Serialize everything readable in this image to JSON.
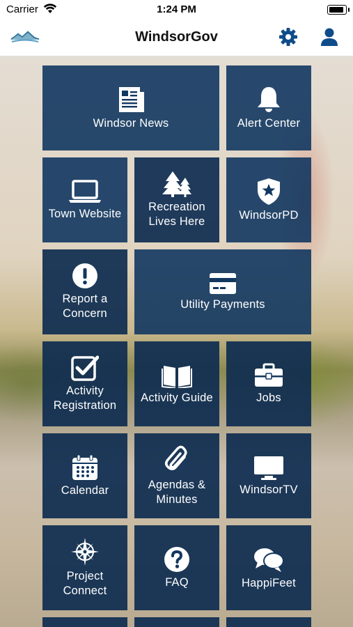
{
  "status_bar": {
    "carrier": "Carrier",
    "time": "1:24 PM",
    "battery_level": 0.9
  },
  "nav_bar": {
    "title": "WindsorGov",
    "logo_icon": "mountains-logo-icon",
    "settings_icon": "gear-icon",
    "account_icon": "user-icon"
  },
  "tiles": [
    {
      "label": "Windsor News",
      "icon": "newspaper-icon"
    },
    {
      "label": "Alert Center",
      "icon": "bell-icon"
    },
    {
      "label": "Town Website",
      "icon": "laptop-icon"
    },
    {
      "label": "Recreation\nLives Here",
      "icon": "trees-icon"
    },
    {
      "label": "WindsorPD",
      "icon": "police-badge-icon"
    },
    {
      "label": "Report a\nConcern",
      "icon": "exclamation-circle-icon"
    },
    {
      "label": "Utility Payments",
      "icon": "credit-card-icon"
    },
    {
      "label": "Activity\nRegistration",
      "icon": "checkbox-icon"
    },
    {
      "label": "Activity Guide",
      "icon": "open-book-icon"
    },
    {
      "label": "Jobs",
      "icon": "briefcase-icon"
    },
    {
      "label": "Calendar",
      "icon": "calendar-icon"
    },
    {
      "label": "Agendas &\nMinutes",
      "icon": "paperclip-icon"
    },
    {
      "label": "WindsorTV",
      "icon": "tv-icon"
    },
    {
      "label": "Project\nConnect",
      "icon": "compass-star-icon"
    },
    {
      "label": "FAQ",
      "icon": "question-circle-icon"
    },
    {
      "label": "HappiFeet",
      "icon": "chat-bubbles-icon"
    }
  ],
  "colors": {
    "tile": "#123760",
    "nav_icon": "#0f4c8a"
  }
}
